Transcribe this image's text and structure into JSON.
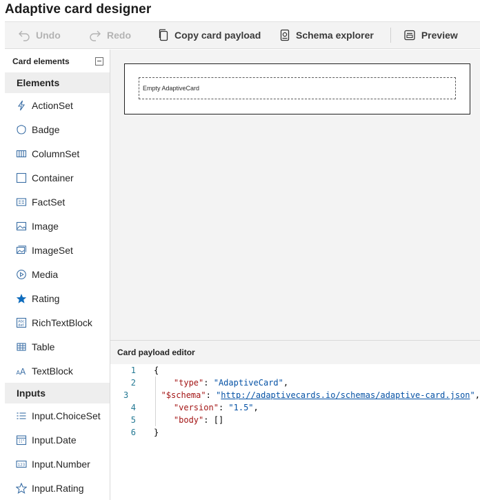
{
  "app": {
    "title": "Adaptive card designer"
  },
  "toolbar": {
    "undo": "Undo",
    "redo": "Redo",
    "copy": "Copy card payload",
    "schema": "Schema explorer",
    "preview": "Preview"
  },
  "sidebar": {
    "title": "Card elements",
    "sections": [
      {
        "label": "Elements",
        "items": [
          {
            "label": "ActionSet",
            "icon": "flash-icon"
          },
          {
            "label": "Badge",
            "icon": "badge-icon"
          },
          {
            "label": "ColumnSet",
            "icon": "columns-icon"
          },
          {
            "label": "Container",
            "icon": "container-icon"
          },
          {
            "label": "FactSet",
            "icon": "factset-icon"
          },
          {
            "label": "Image",
            "icon": "image-icon"
          },
          {
            "label": "ImageSet",
            "icon": "imageset-icon"
          },
          {
            "label": "Media",
            "icon": "media-icon"
          },
          {
            "label": "Rating",
            "icon": "star-filled-icon"
          },
          {
            "label": "RichTextBlock",
            "icon": "richtext-icon"
          },
          {
            "label": "Table",
            "icon": "table-icon"
          },
          {
            "label": "TextBlock",
            "icon": "textblock-icon"
          }
        ]
      },
      {
        "label": "Inputs",
        "items": [
          {
            "label": "Input.ChoiceSet",
            "icon": "list-icon"
          },
          {
            "label": "Input.Date",
            "icon": "calendar-icon"
          },
          {
            "label": "Input.Number",
            "icon": "number-icon"
          },
          {
            "label": "Input.Rating",
            "icon": "star-outline-icon"
          }
        ]
      }
    ]
  },
  "canvas": {
    "empty_label": "Empty AdaptiveCard"
  },
  "editor": {
    "title": "Card payload editor",
    "line_numbers": [
      "1",
      "2",
      "3",
      "4",
      "5",
      "6"
    ],
    "open_brace": "{",
    "close_brace": "}",
    "type_key": "\"type\"",
    "type_value": "\"AdaptiveCard\"",
    "schema_key": "\"$schema\"",
    "schema_value": "http://adaptivecards.io/schemas/adaptive-card.json",
    "version_key": "\"version\"",
    "version_value": "\"1.5\"",
    "body_key": "\"body\"",
    "body_value": "[]"
  },
  "colors": {
    "line_number": "#237893",
    "json_key": "#a31515",
    "json_value": "#0451a5",
    "rating_star": "#0f6cbd"
  }
}
